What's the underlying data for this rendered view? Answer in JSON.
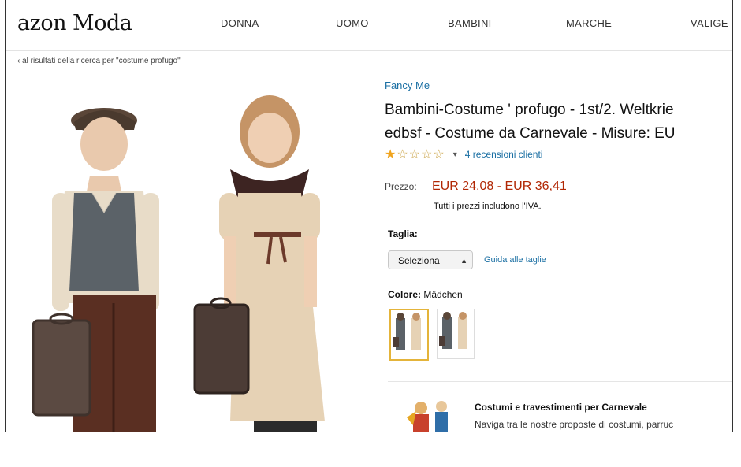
{
  "header": {
    "logo": "azon Moda",
    "nav": [
      "DONNA",
      "UOMO",
      "BAMBINI",
      "MARCHE",
      "VALIGE"
    ]
  },
  "breadcrumb": "‹ al risultati della ricerca per \"costume profugo\"",
  "product": {
    "brand": "Fancy Me",
    "title_line1": "Bambini-Costume ' profugo - 1st/2. Weltkrie",
    "title_line2": "edbsf - Costume da Carnevale - Misure: EU",
    "rating_stars": 1,
    "rating_max": 5,
    "reviews": "4 recensioni clienti",
    "price_label": "Prezzo:",
    "price": "EUR 24,08 - EUR 36,41",
    "vat_note": "Tutti i prezzi includono l'IVA.",
    "size_label": "Taglia:",
    "size_select": "Seleziona",
    "size_guide": "Guida alle taglie",
    "color_label": "Colore:",
    "color_value": "Mädchen"
  },
  "promo": {
    "title": "Costumi e travestimenti per Carnevale",
    "text": "Naviga tra le nostre proposte di costumi, parruc"
  },
  "colors": {
    "link": "#1a6fa3",
    "price": "#b12704",
    "star": "#f0a41e",
    "selected_swatch": "#e4b43a"
  }
}
